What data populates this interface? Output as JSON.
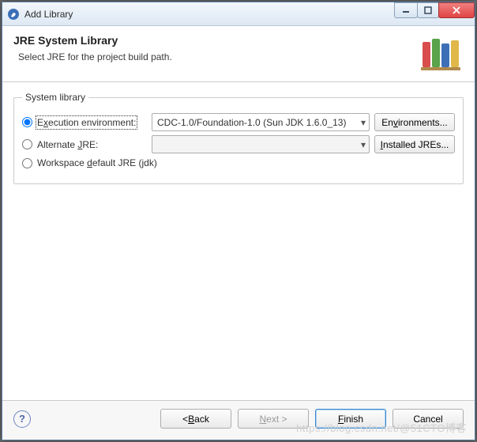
{
  "window": {
    "title": "Add Library"
  },
  "header": {
    "title": "JRE System Library",
    "subtitle": "Select JRE for the project build path."
  },
  "fieldset": {
    "legend": "System library"
  },
  "options": {
    "execution": {
      "label_pre": "E",
      "label_mn": "x",
      "label_post": "ecution environment:",
      "combo_value": "CDC-1.0/Foundation-1.0 (Sun JDK 1.6.0_13)",
      "button_pre": "En",
      "button_mn": "v",
      "button_post": "ironments..."
    },
    "alternate": {
      "label_pre": "Alternate ",
      "label_mn": "J",
      "label_post": "RE:",
      "combo_value": "",
      "button_mn": "I",
      "button_post": "nstalled JREs..."
    },
    "workspace": {
      "label_pre": "Workspace ",
      "label_mn": "d",
      "label_post": "efault JRE (jdk)"
    }
  },
  "footer": {
    "back_pre": "< ",
    "back_mn": "B",
    "back_post": "ack",
    "next_mn": "N",
    "next_post": "ext >",
    "finish_mn": "F",
    "finish_post": "inish",
    "cancel": "Cancel"
  },
  "watermark": "https://blog.csdn.net/@51CTO博客"
}
